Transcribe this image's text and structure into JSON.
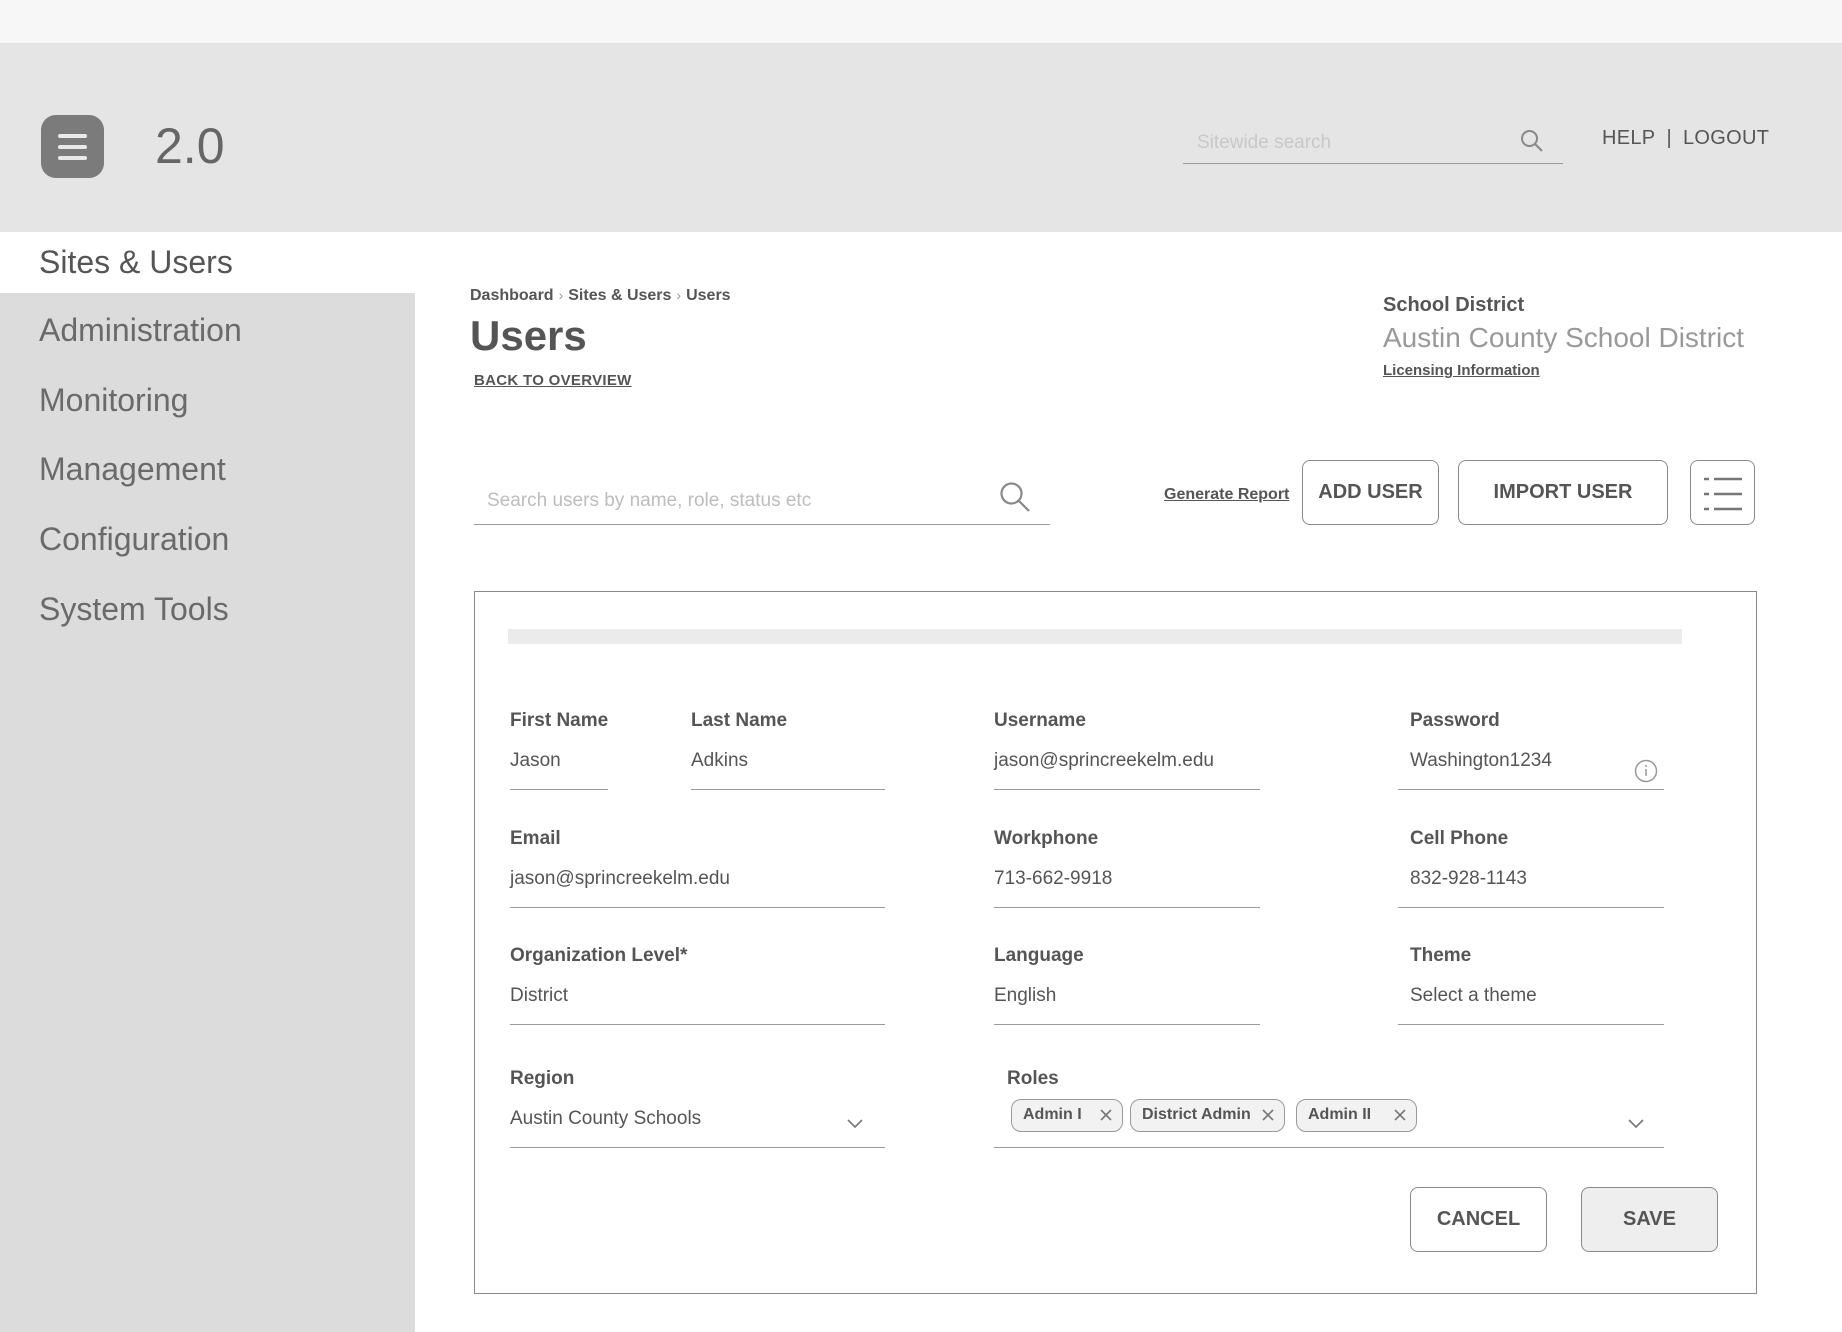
{
  "app": {
    "version": "2.0"
  },
  "header": {
    "search_placeholder": "Sitewide search",
    "help": "HELP",
    "separator": "|",
    "logout": "LOGOUT"
  },
  "sidebar": {
    "items": [
      {
        "label": "Sites & Users",
        "active": true
      },
      {
        "label": "Administration"
      },
      {
        "label": "Monitoring"
      },
      {
        "label": "Management"
      },
      {
        "label": "Configuration"
      },
      {
        "label": "System Tools"
      }
    ]
  },
  "breadcrumb": [
    "Dashboard",
    "Sites & Users",
    "Users"
  ],
  "page": {
    "title": "Users",
    "back_link": "BACK TO OVERVIEW"
  },
  "district": {
    "label": "School District",
    "name": "Austin County School District",
    "licensing": "Licensing Information"
  },
  "toolbar": {
    "search_placeholder": "Search users by name, role, status etc",
    "generate_report": "Generate Report",
    "add_user": "ADD USER",
    "import_user": "IMPORT USER"
  },
  "form": {
    "first_name": {
      "label": "First Name",
      "value": "Jason"
    },
    "last_name": {
      "label": "Last Name",
      "value": "Adkins"
    },
    "username": {
      "label": "Username",
      "value": "jason@sprincreekelm.edu"
    },
    "password": {
      "label": "Password",
      "value": "Washington1234"
    },
    "email": {
      "label": "Email",
      "value": "jason@sprincreekelm.edu"
    },
    "workphone": {
      "label": "Workphone",
      "value": "713-662-9918"
    },
    "cellphone": {
      "label": "Cell Phone",
      "value": "832-928-1143"
    },
    "org_level": {
      "label": "Organization Level*",
      "value": "District"
    },
    "language": {
      "label": "Language",
      "value": "English"
    },
    "theme": {
      "label": "Theme",
      "value": "Select a theme"
    },
    "region": {
      "label": "Region",
      "value": "Austin County Schools"
    },
    "roles": {
      "label": "Roles",
      "chips": [
        "Admin I",
        "District Admin",
        "Admin II"
      ]
    },
    "cancel": "CANCEL",
    "save": "SAVE"
  },
  "icons": {
    "logo": "menu-lines-icon",
    "search": "search-icon",
    "list_view": "list-icon",
    "info": "info-icon",
    "dropdown": "chevron-down-icon",
    "remove": "close-icon"
  }
}
